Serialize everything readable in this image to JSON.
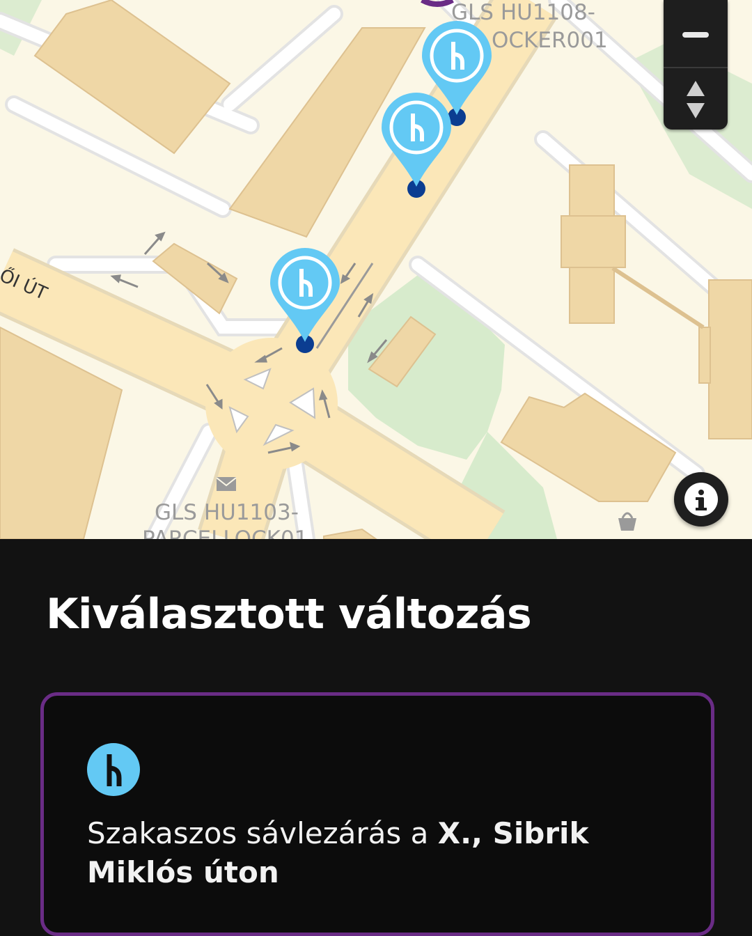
{
  "map": {
    "street_label": "ŐI ÚT",
    "poi_top_line1": "GLS HU1108-",
    "poi_top_line2": "OCKER001",
    "poi_bottom_line1": "GLS HU1103-",
    "poi_bottom_line2": "PARCELLOCK01",
    "markers": [
      "lane-closure",
      "lane-closure",
      "lane-closure"
    ]
  },
  "controls": {
    "zoom_out_icon": "minus-icon",
    "compass_icon": "compass-arrows-icon",
    "info_icon": "info-icon"
  },
  "panel": {
    "title": "Kiválasztott változás",
    "card": {
      "icon": "lane-merge-icon",
      "text_plain": "Szakaszos sávlezárás a ",
      "text_bold": "X., Sibrik Miklós úton"
    }
  },
  "colors": {
    "map_background": "#fbf7e6",
    "road": "#fbe7b8",
    "building": "#efd7a6",
    "park": "#d7ebcc",
    "marker": "#63c9f4",
    "card_border": "#6a2c86",
    "panel_background": "#121212"
  }
}
